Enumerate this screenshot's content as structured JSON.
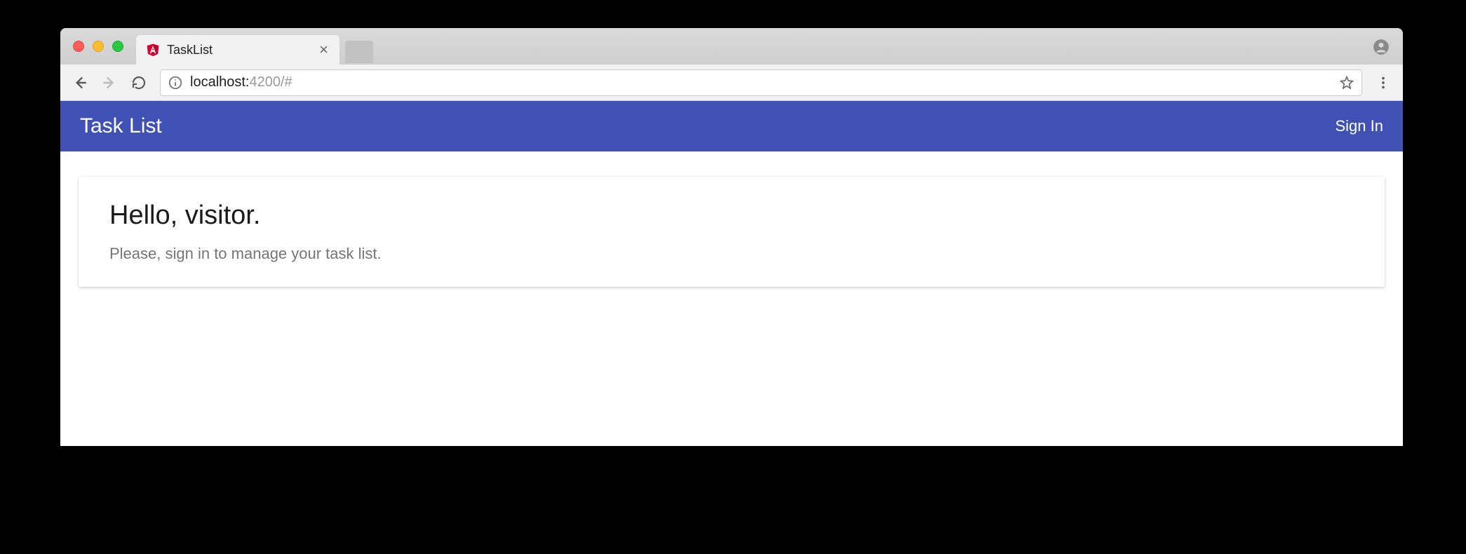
{
  "browser": {
    "tab_title": "TaskList",
    "url_host": "localhost:",
    "url_rest": "4200/#"
  },
  "app": {
    "header": {
      "title": "Task List",
      "signin": "Sign In"
    },
    "card": {
      "heading": "Hello, visitor.",
      "body": "Please, sign in to manage your task list."
    }
  }
}
